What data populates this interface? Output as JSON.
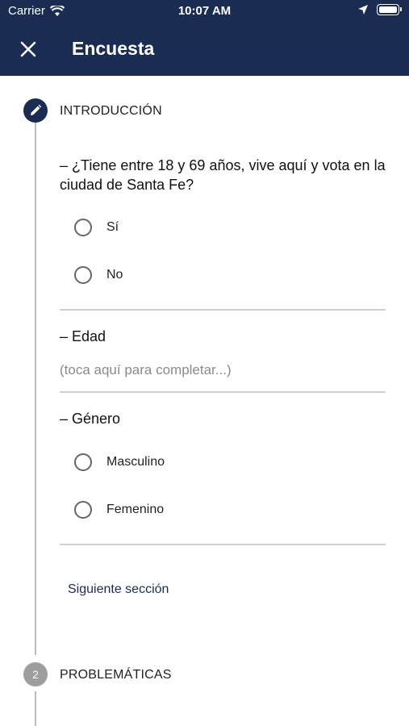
{
  "status_bar": {
    "carrier": "Carrier",
    "time": "10:07 AM"
  },
  "app_bar": {
    "title": "Encuesta",
    "close_icon": "close-icon"
  },
  "steps": [
    {
      "number": "",
      "icon": "pencil-icon",
      "title": "INTRODUCCIÓN",
      "questions": [
        {
          "title": "– ¿Tiene entre 18 y 69 años, vive aquí y vota en la ciudad de Santa Fe?",
          "options": [
            "Sí",
            "No"
          ]
        },
        {
          "title": "– Edad",
          "placeholder": "(toca aquí para completar...)"
        },
        {
          "title": "– Género",
          "options": [
            "Masculino",
            "Femenino"
          ]
        }
      ],
      "next_label": "Siguiente sección"
    },
    {
      "number": "2",
      "title": "PROBLEMÁTICAS"
    }
  ],
  "colors": {
    "primary": "#1b2c53",
    "inactive_step": "#9e9e9e",
    "divider": "#d0d0d0"
  }
}
